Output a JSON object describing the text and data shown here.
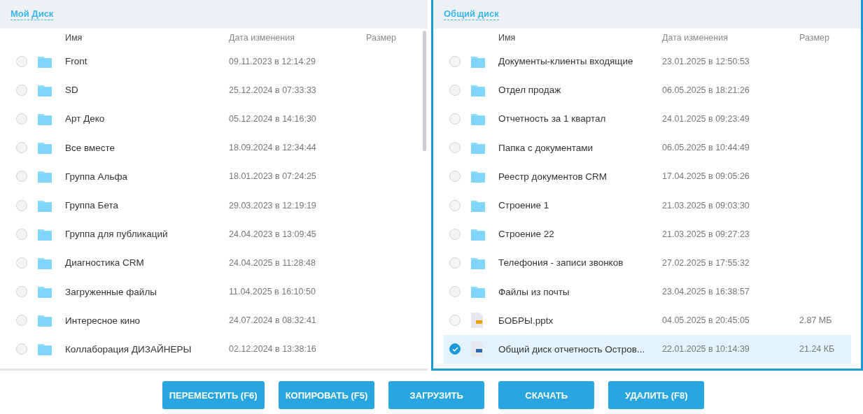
{
  "panels": [
    {
      "title": "Мой Диск",
      "active": false,
      "columns": [
        "Имя",
        "Дата изменения",
        "Размер"
      ],
      "rows": [
        {
          "kind": "folder",
          "name": "Front",
          "date": "09.11.2023 в 12:14:29",
          "selected": false
        },
        {
          "kind": "folder",
          "name": "SD",
          "date": "25.12.2024 в 07:33:33",
          "selected": false
        },
        {
          "kind": "folder",
          "name": "Арт Деко",
          "date": "05.12.2024 в 14:16:30",
          "selected": false
        },
        {
          "kind": "folder",
          "name": "Все вместе",
          "date": "18.09.2024 в 12:34:44",
          "selected": false
        },
        {
          "kind": "folder",
          "name": "Группа Альфа",
          "date": "18.01.2023 в 07:24:25",
          "selected": false
        },
        {
          "kind": "folder",
          "name": "Группа Бета",
          "date": "29.03.2023 в 12:19:19",
          "selected": false
        },
        {
          "kind": "folder",
          "name": "Группа для публикаций",
          "date": "24.04.2023 в 13:09:45",
          "selected": false
        },
        {
          "kind": "folder",
          "name": "Диагностика CRM",
          "date": "24.04.2025 в 11:28:48",
          "selected": false
        },
        {
          "kind": "folder",
          "name": "Загруженные файлы",
          "date": "11.04.2025 в 16:10:50",
          "selected": false
        },
        {
          "kind": "folder",
          "name": "Интересное кино",
          "date": "24.07.2024 в 08:32:41",
          "selected": false
        },
        {
          "kind": "folder",
          "name": "Коллаборация ДИЗАЙНЕРЫ",
          "date": "02.12.2024 в 13:38:16",
          "selected": false
        }
      ]
    },
    {
      "title": "Общий диск",
      "active": true,
      "columns": [
        "Имя",
        "Дата изменения",
        "Размер"
      ],
      "rows": [
        {
          "kind": "folder",
          "name": "Документы-клиенты входящие",
          "date": "23.01.2025 в 12:50:53",
          "selected": false
        },
        {
          "kind": "folder",
          "name": "Отдел продаж",
          "date": "06.05.2025 в 18:21:26",
          "selected": false
        },
        {
          "kind": "folder",
          "name": "Отчетность за 1 квартал",
          "date": "24.01.2025 в 09:23:49",
          "selected": false
        },
        {
          "kind": "folder",
          "name": "Папка с документами",
          "date": "06.05.2025 в 10:44:49",
          "selected": false
        },
        {
          "kind": "folder",
          "name": "Реестр документов CRM",
          "date": "17.04.2025 в 09:05:26",
          "selected": false
        },
        {
          "kind": "folder",
          "name": "Строение 1",
          "date": "21.03.2025 в 09:03:30",
          "selected": false
        },
        {
          "kind": "folder",
          "name": "Строение 22",
          "date": "21.03.2025 в 09:27:23",
          "selected": false
        },
        {
          "kind": "folder",
          "name": "Телефония - записи звонков",
          "date": "27.02.2025 в 17:55:32",
          "selected": false
        },
        {
          "kind": "folder",
          "name": "Файлы из почты",
          "date": "23.04.2025 в 16:38:57",
          "selected": false
        },
        {
          "kind": "presentation",
          "name": "БОБРЫ.pptx",
          "date": "04.05.2025 в 20:45:05",
          "size": "2.87 МБ",
          "selected": false
        },
        {
          "kind": "document",
          "name": "Общий диск отчетность Остров...",
          "date": "22.01.2025 в 10:14:39",
          "size": "21.24 КБ",
          "selected": true
        }
      ]
    }
  ],
  "buttons": [
    "ПЕРЕМЕСТИТЬ (F6)",
    "КОПИРОВАТЬ (F5)",
    "ЗАГРУЗИТЬ",
    "СКАЧАТЬ",
    "УДАЛИТЬ (F8)"
  ]
}
